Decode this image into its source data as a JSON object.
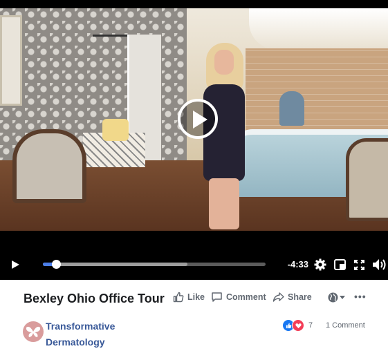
{
  "video": {
    "time_remaining": "-4:33",
    "progress_played": 0.06,
    "progress_buffered": 0.65
  },
  "post": {
    "title": "Bexley Ohio Office Tour",
    "actions": {
      "like": "Like",
      "comment": "Comment",
      "share": "Share"
    },
    "more_label": "•••"
  },
  "page": {
    "name_line1": "Transformative",
    "name_line2": "Dermatology"
  },
  "engagement": {
    "reaction_count": "7",
    "comments": "1 Comment"
  },
  "colors": {
    "accent_blue": "#4a7de8",
    "link_blue": "#385898",
    "like_blue": "#1877f2",
    "love_red": "#f33e58"
  },
  "icons": [
    "play-icon",
    "settings-gear-icon",
    "picture-in-picture-icon",
    "fullscreen-icon",
    "volume-icon",
    "thumbs-up-icon",
    "comment-icon",
    "share-icon",
    "globe-icon",
    "butterfly-logo-icon"
  ]
}
